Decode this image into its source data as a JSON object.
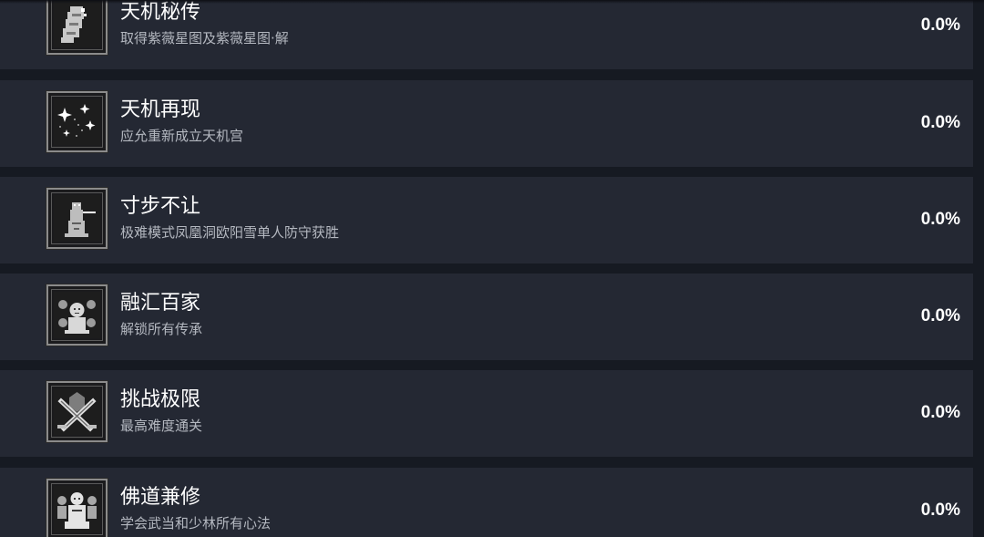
{
  "achievements": [
    {
      "title": "天机秘传",
      "desc": "取得紫薇星图及紫薇星图·解",
      "percent": "0.0%",
      "icon": "scroll-icon"
    },
    {
      "title": "天机再现",
      "desc": "应允重新成立天机宫",
      "percent": "0.0%",
      "icon": "stars-icon"
    },
    {
      "title": "寸步不让",
      "desc": "极难模式凤凰洞欧阳雪单人防守获胜",
      "percent": "0.0%",
      "icon": "warrior-icon"
    },
    {
      "title": "融汇百家",
      "desc": "解锁所有传承",
      "percent": "0.0%",
      "icon": "masters-icon"
    },
    {
      "title": "挑战极限",
      "desc": "最高难度通关",
      "percent": "0.0%",
      "icon": "crossed-swords-icon"
    },
    {
      "title": "佛道兼修",
      "desc": "学会武当和少林所有心法",
      "percent": "0.0%",
      "icon": "monk-icon"
    }
  ]
}
